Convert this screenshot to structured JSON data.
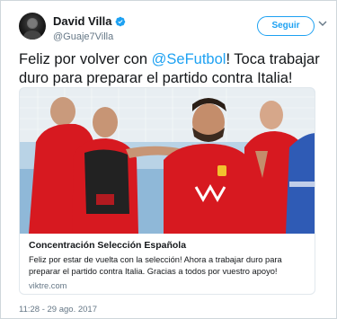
{
  "author": {
    "display_name": "David Villa",
    "handle": "@Guaje7Villa",
    "verified": true
  },
  "follow_button": {
    "label": "Seguir"
  },
  "tweet": {
    "text_before": "Feliz por volver con ",
    "mention": "@SeFutbol",
    "text_after": "! Toca trabajar duro para preparar el partido contra Italia!"
  },
  "card": {
    "title": "Concentración Selección Española",
    "description": "Feliz por estar de vuelta con la selección! Ahora a trabajar duro para preparar el partido contra Italia. Gracias a todos por vuestro apoyo!",
    "domain": "viktre.com"
  },
  "timestamp": "11:28 - 29 ago. 2017",
  "colors": {
    "accent": "#1da1f2",
    "jersey_red": "#d71920",
    "text_secondary": "#657786"
  },
  "icons": {
    "verified": "verified-badge-icon",
    "menu": "chevron-down-icon"
  }
}
